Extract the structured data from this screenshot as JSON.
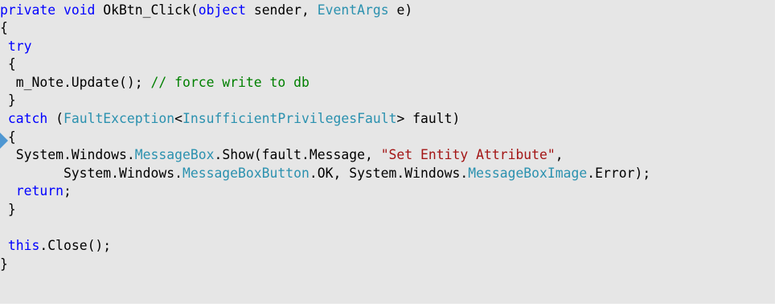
{
  "colors": {
    "background": "#e6e6e6",
    "keyword": "#0000ff",
    "type": "#2b91af",
    "string": "#a31515",
    "comment": "#008000",
    "text": "#000000",
    "execution_marker": "#4f97d2"
  },
  "execution_marker_icon": "current-statement-arrow-icon",
  "lines": [
    [
      {
        "k": "kw",
        "t": "private"
      },
      {
        "k": "plain",
        "t": " "
      },
      {
        "k": "kw",
        "t": "void"
      },
      {
        "k": "plain",
        "t": " OkBtn_Click("
      },
      {
        "k": "kw",
        "t": "object"
      },
      {
        "k": "plain",
        "t": " sender, "
      },
      {
        "k": "type",
        "t": "EventArgs"
      },
      {
        "k": "plain",
        "t": " e)"
      }
    ],
    [
      {
        "k": "plain",
        "t": "{"
      }
    ],
    [
      {
        "k": "plain",
        "t": " "
      },
      {
        "k": "kw",
        "t": "try"
      }
    ],
    [
      {
        "k": "plain",
        "t": " {"
      }
    ],
    [
      {
        "k": "plain",
        "t": "  m_Note.Update(); "
      },
      {
        "k": "com",
        "t": "// force write to db"
      }
    ],
    [
      {
        "k": "plain",
        "t": " }"
      }
    ],
    [
      {
        "k": "plain",
        "t": " "
      },
      {
        "k": "kw",
        "t": "catch"
      },
      {
        "k": "plain",
        "t": " ("
      },
      {
        "k": "type",
        "t": "FaultException"
      },
      {
        "k": "plain",
        "t": "<"
      },
      {
        "k": "type",
        "t": "InsufficientPrivilegesFault"
      },
      {
        "k": "plain",
        "t": "> fault)"
      }
    ],
    [
      {
        "k": "plain",
        "t": " {"
      }
    ],
    [
      {
        "k": "plain",
        "t": "  System.Windows."
      },
      {
        "k": "type",
        "t": "MessageBox"
      },
      {
        "k": "plain",
        "t": ".Show(fault.Message, "
      },
      {
        "k": "str",
        "t": "\"Set Entity Attribute\""
      },
      {
        "k": "plain",
        "t": ","
      }
    ],
    [
      {
        "k": "plain",
        "t": "        System.Windows."
      },
      {
        "k": "type",
        "t": "MessageBoxButton"
      },
      {
        "k": "plain",
        "t": ".OK, System.Windows."
      },
      {
        "k": "type",
        "t": "MessageBoxImage"
      },
      {
        "k": "plain",
        "t": ".Error);"
      }
    ],
    [
      {
        "k": "plain",
        "t": "  "
      },
      {
        "k": "kw",
        "t": "return"
      },
      {
        "k": "plain",
        "t": ";"
      }
    ],
    [
      {
        "k": "plain",
        "t": " }"
      }
    ],
    [],
    [
      {
        "k": "plain",
        "t": " "
      },
      {
        "k": "kw",
        "t": "this"
      },
      {
        "k": "plain",
        "t": ".Close();"
      }
    ],
    [
      {
        "k": "plain",
        "t": "}"
      }
    ]
  ]
}
